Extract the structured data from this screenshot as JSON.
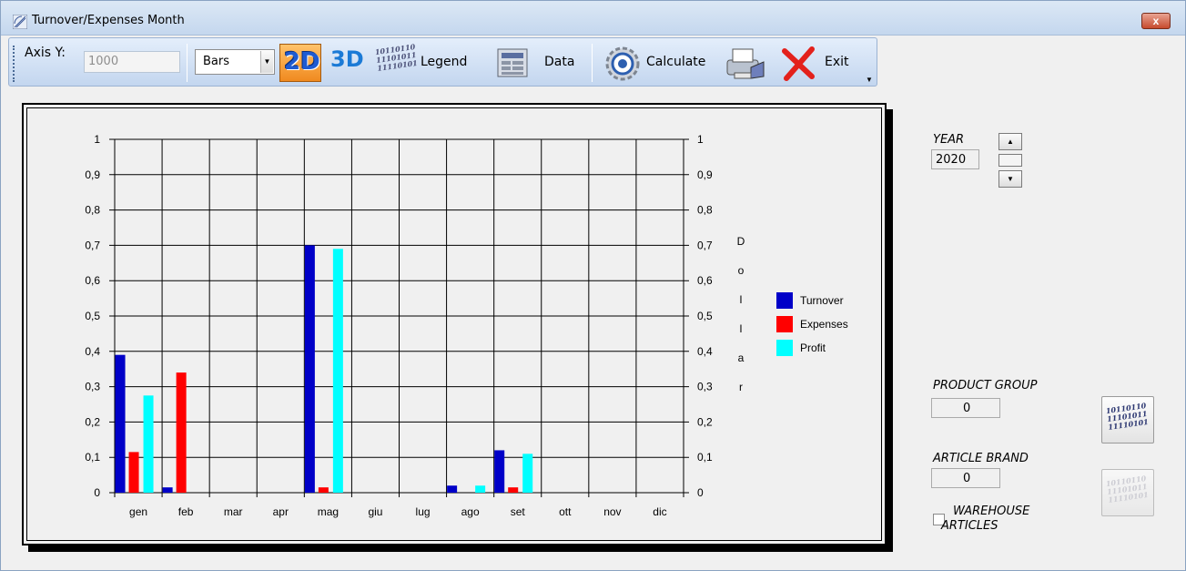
{
  "window": {
    "title": "Turnover/Expenses Month",
    "close_label": "x"
  },
  "toolbar": {
    "axis_y_label": "Axis Y:",
    "axis_y_value": "1000",
    "chart_type": "Bars",
    "btn_2d": "2D",
    "btn_3d": "3D",
    "legend_label": "Legend",
    "data_label": "Data",
    "calculate_label": "Calculate",
    "exit_label": "Exit",
    "binary_text": "10110110 11101011 11110101"
  },
  "side": {
    "year_label": "YEAR",
    "year_value": "2020",
    "product_group_label": "PRODUCT GROUP",
    "product_group_value": "0",
    "article_brand_label": "ARTICLE BRAND",
    "article_brand_value": "0",
    "warehouse_line1": "WAREHOUSE",
    "warehouse_line2": "ARTICLES",
    "warehouse_checked": false
  },
  "chart_data": {
    "type": "bar",
    "categories": [
      "gen",
      "feb",
      "mar",
      "apr",
      "mag",
      "giu",
      "lug",
      "ago",
      "set",
      "ott",
      "nov",
      "dic"
    ],
    "series": [
      {
        "name": "Turnover",
        "color": "#0000c8",
        "values": [
          0.39,
          0.015,
          0,
          0,
          0.7,
          0,
          0,
          0.02,
          0.12,
          0,
          0,
          0
        ]
      },
      {
        "name": "Expenses",
        "color": "#ff0000",
        "values": [
          0.115,
          0.34,
          0,
          0,
          0.015,
          0,
          0,
          0,
          0.015,
          0,
          0,
          0
        ]
      },
      {
        "name": "Profit",
        "color": "#00ffff",
        "values": [
          0.275,
          0,
          0,
          0,
          0.69,
          0,
          0,
          0.02,
          0.11,
          0,
          0,
          0
        ]
      }
    ],
    "ylim": [
      0,
      1
    ],
    "yticks": [
      "0",
      "0,1",
      "0,2",
      "0,3",
      "0,4",
      "0,5",
      "0,6",
      "0,7",
      "0,8",
      "0,9",
      "1"
    ],
    "ylabel_right": "Dollar",
    "grid": true,
    "legend_position": "right"
  }
}
